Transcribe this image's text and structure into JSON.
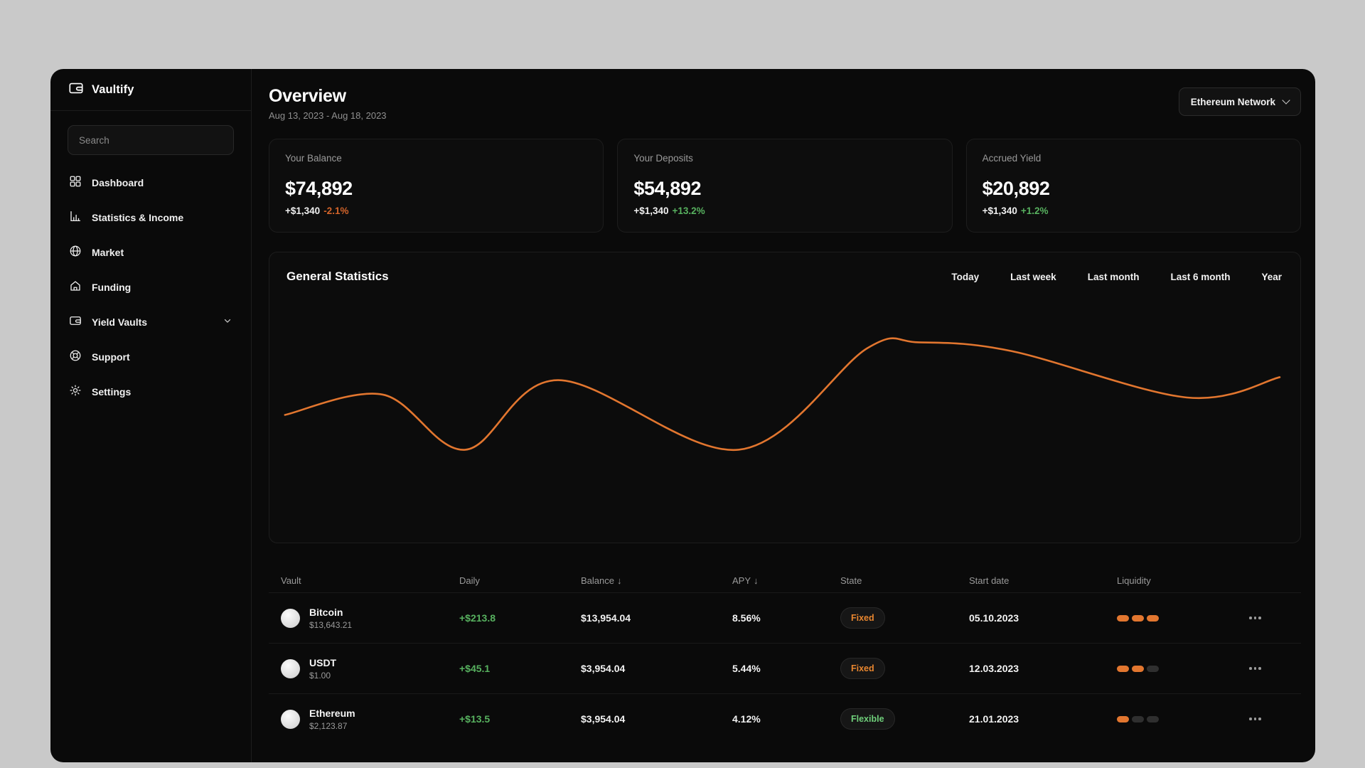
{
  "app": {
    "name": "Vaultify"
  },
  "colors": {
    "page_bg": "#c9c9c9",
    "window_bg": "#0a0a0a",
    "accent_orange": "#e2762f",
    "positive_green": "#57b15f",
    "negative_orange": "#d3642a"
  },
  "sidebar": {
    "search": {
      "placeholder": "Search"
    },
    "items": [
      {
        "label": "Dashboard",
        "icon": "dashboard-grid-icon"
      },
      {
        "label": "Statistics & Income",
        "icon": "bar-chart-icon"
      },
      {
        "label": "Market",
        "icon": "globe-icon"
      },
      {
        "label": "Funding",
        "icon": "home-icon"
      },
      {
        "label": "Yield Vaults",
        "icon": "wallet-icon",
        "has_submenu": true
      },
      {
        "label": "Support",
        "icon": "lifebuoy-icon"
      },
      {
        "label": "Settings",
        "icon": "gear-icon"
      }
    ]
  },
  "header": {
    "title": "Overview",
    "date_range": "Aug 13, 2023 - Aug 18, 2023",
    "network_selector": {
      "label": "Ethereum Network",
      "icon": "chevron-down-icon"
    }
  },
  "stat_cards": [
    {
      "label": "Your Balance",
      "value": "$74,892",
      "delta": "+$1,340",
      "percent": "-2.1%",
      "direction": "down"
    },
    {
      "label": "Your Deposits",
      "value": "$54,892",
      "delta": "+$1,340",
      "percent": "+13.2%",
      "direction": "up"
    },
    {
      "label": "Accrued Yield",
      "value": "$20,892",
      "delta": "+$1,340",
      "percent": "+1.2%",
      "direction": "up"
    }
  ],
  "statistics": {
    "title": "General Statistics",
    "filters": [
      "Today",
      "Last week",
      "Last month",
      "Last 6 month",
      "Year"
    ]
  },
  "chart_data": {
    "type": "line",
    "title": "General Statistics",
    "smooth": true,
    "line_color": "#e2762f",
    "axes_visible": false,
    "grid": false,
    "legend": false,
    "xlabel": "",
    "ylabel": "",
    "x_pct": [
      1.5,
      11,
      19,
      28,
      45.5,
      58,
      63,
      72,
      89,
      98
    ],
    "y_pct": [
      44,
      51,
      32,
      56,
      32,
      67,
      69,
      66,
      50,
      57
    ]
  },
  "table": {
    "row_menu_icon": "ellipsis-icon",
    "columns": [
      {
        "label": "Vault",
        "sort": ""
      },
      {
        "label": "Daily",
        "sort": ""
      },
      {
        "label": "Balance",
        "sort": "↓"
      },
      {
        "label": "APY",
        "sort": "↓"
      },
      {
        "label": "State",
        "sort": ""
      },
      {
        "label": "Start date",
        "sort": ""
      },
      {
        "label": "Liquidity",
        "sort": ""
      }
    ],
    "rows": [
      {
        "asset": "Bitcoin",
        "price": "$13,643.21",
        "daily": "+$213.8",
        "balance": "$13,954.04",
        "apy": "8.56%",
        "state": "Fixed",
        "state_type": "fixed",
        "start_date": "05.10.2023",
        "liquidity_filled": 3,
        "liquidity_total": 3
      },
      {
        "asset": "USDT",
        "price": "$1.00",
        "daily": "+$45.1",
        "balance": "$3,954.04",
        "apy": "5.44%",
        "state": "Fixed",
        "state_type": "fixed",
        "start_date": "12.03.2023",
        "liquidity_filled": 2,
        "liquidity_total": 3
      },
      {
        "asset": "Ethereum",
        "price": "$2,123.87",
        "daily": "+$13.5",
        "balance": "$3,954.04",
        "apy": "4.12%",
        "state": "Flexible",
        "state_type": "flexible",
        "start_date": "21.01.2023",
        "liquidity_filled": 1,
        "liquidity_total": 3
      }
    ]
  }
}
